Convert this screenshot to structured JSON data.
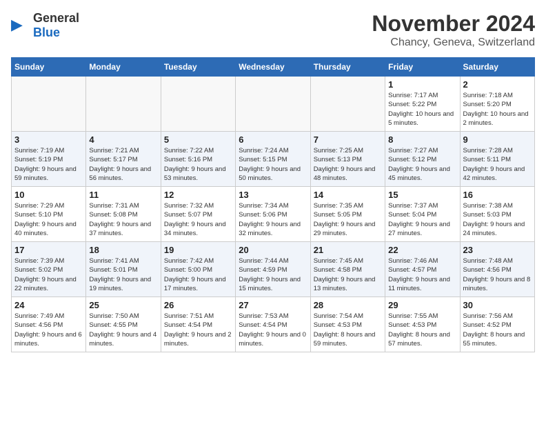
{
  "logo": {
    "text_general": "General",
    "text_blue": "Blue"
  },
  "title": "November 2024",
  "subtitle": "Chancy, Geneva, Switzerland",
  "days_of_week": [
    "Sunday",
    "Monday",
    "Tuesday",
    "Wednesday",
    "Thursday",
    "Friday",
    "Saturday"
  ],
  "weeks": [
    [
      {
        "day": "",
        "info": ""
      },
      {
        "day": "",
        "info": ""
      },
      {
        "day": "",
        "info": ""
      },
      {
        "day": "",
        "info": ""
      },
      {
        "day": "",
        "info": ""
      },
      {
        "day": "1",
        "info": "Sunrise: 7:17 AM\nSunset: 5:22 PM\nDaylight: 10 hours and 5 minutes."
      },
      {
        "day": "2",
        "info": "Sunrise: 7:18 AM\nSunset: 5:20 PM\nDaylight: 10 hours and 2 minutes."
      }
    ],
    [
      {
        "day": "3",
        "info": "Sunrise: 7:19 AM\nSunset: 5:19 PM\nDaylight: 9 hours and 59 minutes."
      },
      {
        "day": "4",
        "info": "Sunrise: 7:21 AM\nSunset: 5:17 PM\nDaylight: 9 hours and 56 minutes."
      },
      {
        "day": "5",
        "info": "Sunrise: 7:22 AM\nSunset: 5:16 PM\nDaylight: 9 hours and 53 minutes."
      },
      {
        "day": "6",
        "info": "Sunrise: 7:24 AM\nSunset: 5:15 PM\nDaylight: 9 hours and 50 minutes."
      },
      {
        "day": "7",
        "info": "Sunrise: 7:25 AM\nSunset: 5:13 PM\nDaylight: 9 hours and 48 minutes."
      },
      {
        "day": "8",
        "info": "Sunrise: 7:27 AM\nSunset: 5:12 PM\nDaylight: 9 hours and 45 minutes."
      },
      {
        "day": "9",
        "info": "Sunrise: 7:28 AM\nSunset: 5:11 PM\nDaylight: 9 hours and 42 minutes."
      }
    ],
    [
      {
        "day": "10",
        "info": "Sunrise: 7:29 AM\nSunset: 5:10 PM\nDaylight: 9 hours and 40 minutes."
      },
      {
        "day": "11",
        "info": "Sunrise: 7:31 AM\nSunset: 5:08 PM\nDaylight: 9 hours and 37 minutes."
      },
      {
        "day": "12",
        "info": "Sunrise: 7:32 AM\nSunset: 5:07 PM\nDaylight: 9 hours and 34 minutes."
      },
      {
        "day": "13",
        "info": "Sunrise: 7:34 AM\nSunset: 5:06 PM\nDaylight: 9 hours and 32 minutes."
      },
      {
        "day": "14",
        "info": "Sunrise: 7:35 AM\nSunset: 5:05 PM\nDaylight: 9 hours and 29 minutes."
      },
      {
        "day": "15",
        "info": "Sunrise: 7:37 AM\nSunset: 5:04 PM\nDaylight: 9 hours and 27 minutes."
      },
      {
        "day": "16",
        "info": "Sunrise: 7:38 AM\nSunset: 5:03 PM\nDaylight: 9 hours and 24 minutes."
      }
    ],
    [
      {
        "day": "17",
        "info": "Sunrise: 7:39 AM\nSunset: 5:02 PM\nDaylight: 9 hours and 22 minutes."
      },
      {
        "day": "18",
        "info": "Sunrise: 7:41 AM\nSunset: 5:01 PM\nDaylight: 9 hours and 19 minutes."
      },
      {
        "day": "19",
        "info": "Sunrise: 7:42 AM\nSunset: 5:00 PM\nDaylight: 9 hours and 17 minutes."
      },
      {
        "day": "20",
        "info": "Sunrise: 7:44 AM\nSunset: 4:59 PM\nDaylight: 9 hours and 15 minutes."
      },
      {
        "day": "21",
        "info": "Sunrise: 7:45 AM\nSunset: 4:58 PM\nDaylight: 9 hours and 13 minutes."
      },
      {
        "day": "22",
        "info": "Sunrise: 7:46 AM\nSunset: 4:57 PM\nDaylight: 9 hours and 11 minutes."
      },
      {
        "day": "23",
        "info": "Sunrise: 7:48 AM\nSunset: 4:56 PM\nDaylight: 9 hours and 8 minutes."
      }
    ],
    [
      {
        "day": "24",
        "info": "Sunrise: 7:49 AM\nSunset: 4:56 PM\nDaylight: 9 hours and 6 minutes."
      },
      {
        "day": "25",
        "info": "Sunrise: 7:50 AM\nSunset: 4:55 PM\nDaylight: 9 hours and 4 minutes."
      },
      {
        "day": "26",
        "info": "Sunrise: 7:51 AM\nSunset: 4:54 PM\nDaylight: 9 hours and 2 minutes."
      },
      {
        "day": "27",
        "info": "Sunrise: 7:53 AM\nSunset: 4:54 PM\nDaylight: 9 hours and 0 minutes."
      },
      {
        "day": "28",
        "info": "Sunrise: 7:54 AM\nSunset: 4:53 PM\nDaylight: 8 hours and 59 minutes."
      },
      {
        "day": "29",
        "info": "Sunrise: 7:55 AM\nSunset: 4:53 PM\nDaylight: 8 hours and 57 minutes."
      },
      {
        "day": "30",
        "info": "Sunrise: 7:56 AM\nSunset: 4:52 PM\nDaylight: 8 hours and 55 minutes."
      }
    ]
  ]
}
